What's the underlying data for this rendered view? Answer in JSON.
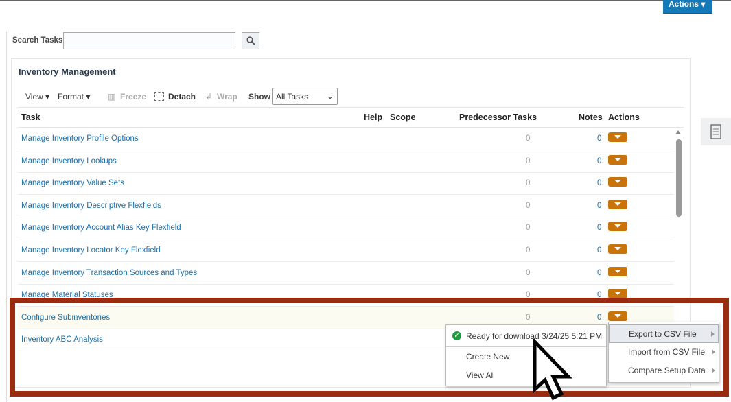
{
  "header": {
    "actions_label": "Actions ▾"
  },
  "search": {
    "label": "Search Tasks",
    "value": ""
  },
  "panel": {
    "title": "Inventory Management"
  },
  "toolbar": {
    "view": "View ▾",
    "format": "Format ▾",
    "freeze": "Freeze",
    "detach": "Detach",
    "wrap": "Wrap",
    "show": "Show",
    "show_value": "All Tasks"
  },
  "columns": {
    "task": "Task",
    "help": "Help",
    "scope": "Scope",
    "pred": "Predecessor Tasks",
    "notes": "Notes",
    "actions": "Actions"
  },
  "rows": [
    {
      "task": "Manage Inventory Profile Options",
      "pred": "0",
      "notes": "0"
    },
    {
      "task": "Manage Inventory Lookups",
      "pred": "0",
      "notes": "0"
    },
    {
      "task": "Manage Inventory Value Sets",
      "pred": "0",
      "notes": "0"
    },
    {
      "task": "Manage Inventory Descriptive Flexfields",
      "pred": "0",
      "notes": "0"
    },
    {
      "task": "Manage Inventory Account Alias Key Flexfield",
      "pred": "0",
      "notes": "0"
    },
    {
      "task": "Manage Inventory Locator Key Flexfield",
      "pred": "0",
      "notes": "0"
    },
    {
      "task": "Manage Inventory Transaction Sources and Types",
      "pred": "0",
      "notes": "0"
    },
    {
      "task": "Manage Material Statuses",
      "pred": "0",
      "notes": "0"
    },
    {
      "task": "Configure Subinventories",
      "pred": "0",
      "notes": "0"
    },
    {
      "task": "Inventory ABC Analysis",
      "pred": "",
      "notes": ""
    }
  ],
  "popup": {
    "status": "Ready for download 3/24/25 5:21 PM",
    "create_new": "Create New",
    "view_all": "View All"
  },
  "submenu": {
    "export": "Export to CSV File",
    "import": "Import from CSV File",
    "compare": "Compare Setup Data"
  },
  "colors": {
    "accent": "#1579b8",
    "action_button": "#c8740a",
    "frame": "#9a2a10"
  }
}
